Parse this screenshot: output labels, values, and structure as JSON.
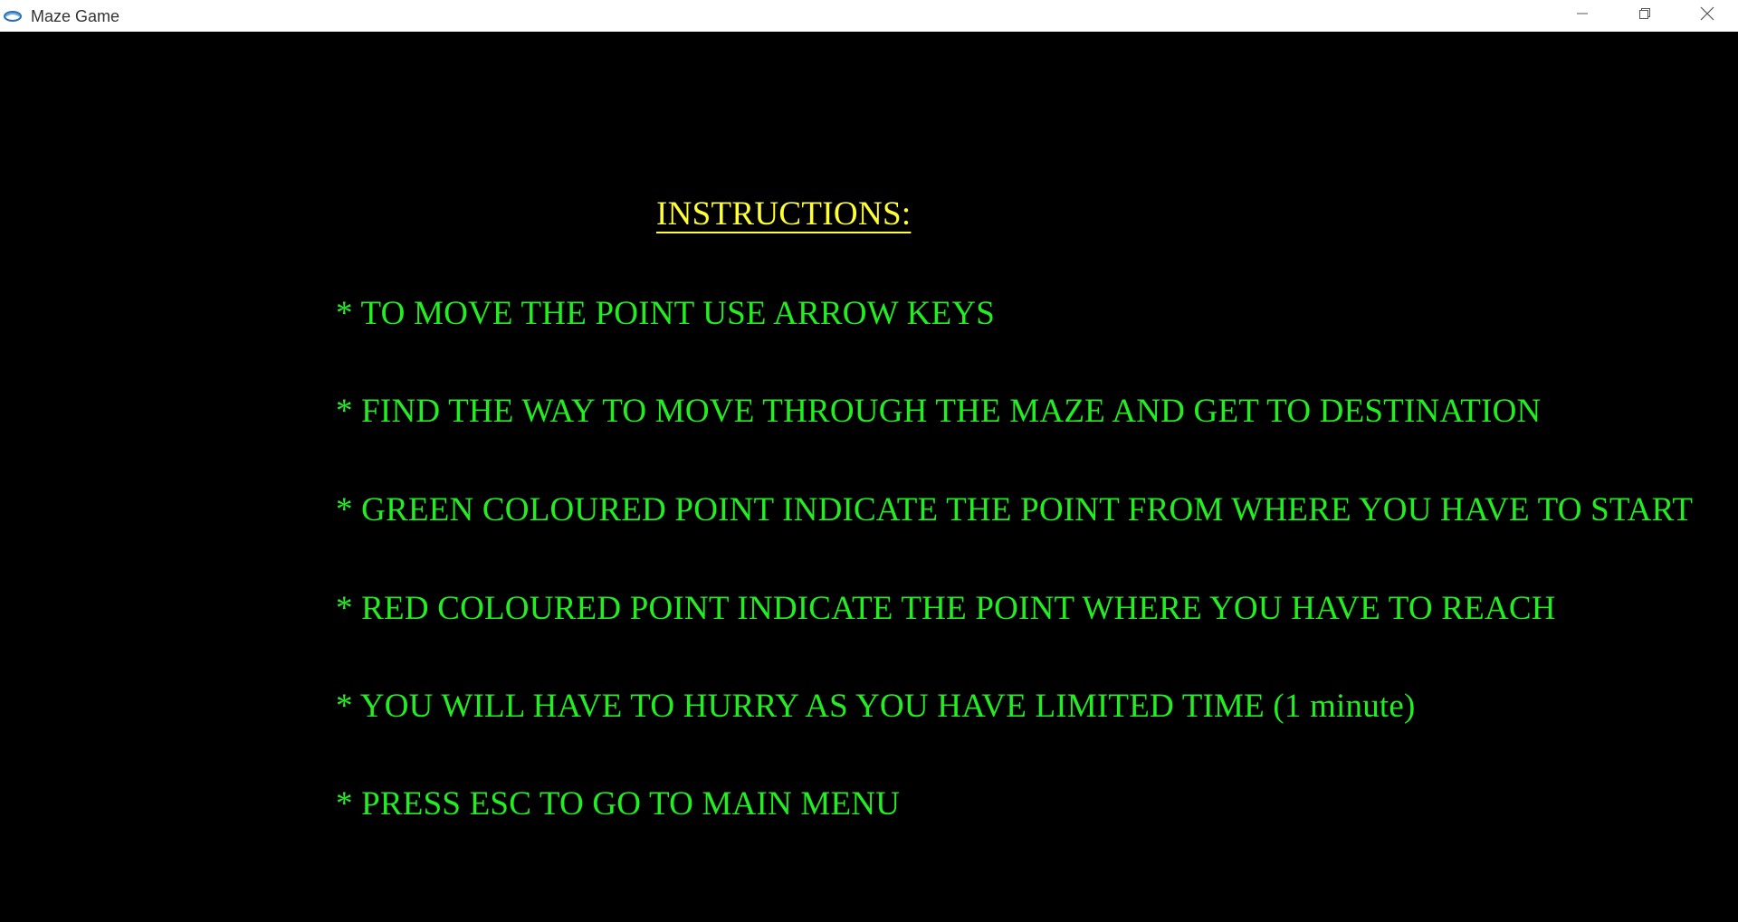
{
  "window": {
    "title": "Maze Game",
    "icon": "app-icon",
    "controls": [
      "minimize-icon",
      "restore-icon",
      "close-icon"
    ]
  },
  "screen": {
    "heading": "INSTRUCTIONS:",
    "instructions": [
      "* TO MOVE THE POINT USE ARROW KEYS",
      "* FIND THE WAY TO MOVE THROUGH THE MAZE AND GET TO DESTINATION",
      "* GREEN COLOURED POINT INDICATE THE POINT FROM WHERE YOU HAVE TO START",
      "* RED COLOURED POINT INDICATE THE POINT WHERE YOU HAVE TO REACH",
      "* YOU WILL HAVE TO HURRY AS YOU HAVE LIMITED TIME (1 minute)",
      "* PRESS ESC TO GO TO MAIN MENU"
    ]
  },
  "colors": {
    "background": "#000000",
    "heading": "#ffff33",
    "instruction_text": "#22ee22",
    "titlebar": "#ffffff"
  }
}
